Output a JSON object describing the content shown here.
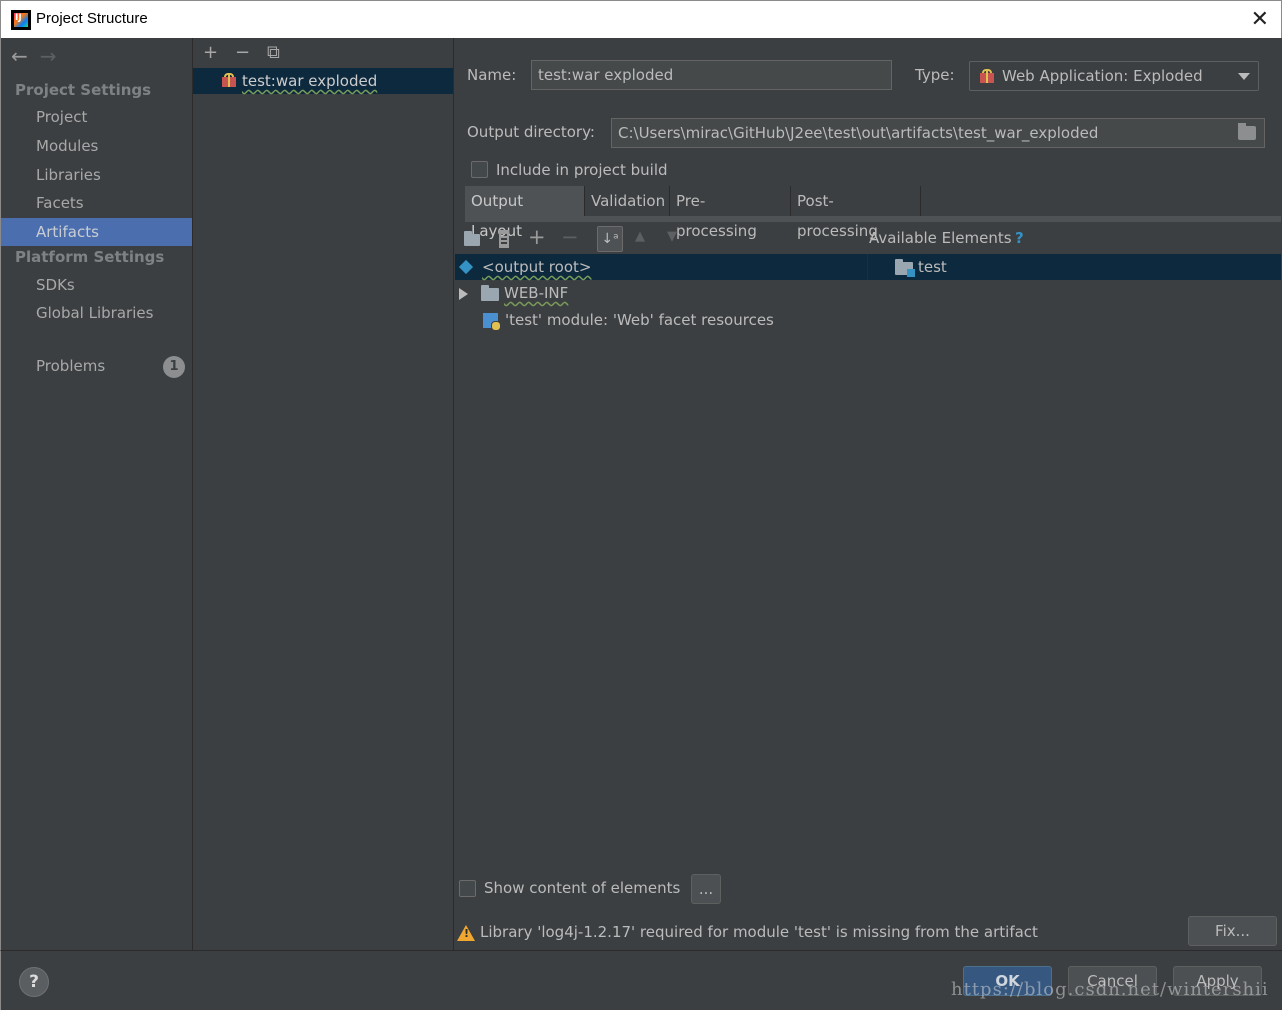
{
  "window": {
    "title": "Project Structure",
    "close_glyph": "✕"
  },
  "nav": {
    "back_glyph": "←",
    "forward_glyph": "→",
    "project_settings_header": "Project Settings",
    "project_items": [
      {
        "label": "Project"
      },
      {
        "label": "Modules"
      },
      {
        "label": "Libraries"
      },
      {
        "label": "Facets"
      },
      {
        "label": "Artifacts",
        "selected": true
      }
    ],
    "platform_settings_header": "Platform Settings",
    "platform_items": [
      {
        "label": "SDKs"
      },
      {
        "label": "Global Libraries"
      }
    ],
    "problems": {
      "label": "Problems",
      "count": "1"
    }
  },
  "artifacts_list": {
    "add_glyph": "+",
    "remove_glyph": "−",
    "copy_glyph": "⧉",
    "items": [
      {
        "label": "test:war exploded"
      }
    ]
  },
  "artifact": {
    "name_label": "Name:",
    "name_value": "test:war exploded",
    "type_label": "Type:",
    "type_value": "Web Application: Exploded",
    "output_dir_label": "Output directory:",
    "output_dir_value": "C:\\Users\\mirac\\GitHub\\J2ee\\test\\out\\artifacts\\test_war_exploded",
    "include_in_build_label": "Include in project build",
    "include_in_build_checked": false
  },
  "tabs": [
    {
      "label": "Output Layout",
      "active": true
    },
    {
      "label": "Validation"
    },
    {
      "label": "Pre-processing"
    },
    {
      "label": "Post-processing"
    }
  ],
  "layout_toolbar": {
    "add_glyph": "+",
    "remove_glyph": "−",
    "sort_glyph": "↓ᵃ",
    "up_glyph": "▲",
    "down_glyph": "▼",
    "available_elements_label": "Available Elements",
    "help_glyph": "?"
  },
  "output_tree": [
    {
      "label": "<output root>"
    },
    {
      "label": "WEB-INF"
    },
    {
      "label": "'test' module: 'Web' facet resources"
    }
  ],
  "available_tree": [
    {
      "label": "test"
    }
  ],
  "show_content": {
    "label": "Show content of elements",
    "checked": false,
    "ellipsis_label": "..."
  },
  "warning": {
    "message": "Library 'log4j-1.2.17' required for module 'test' is missing from the artifact",
    "fix_label": "Fix..."
  },
  "dialog_buttons": {
    "help_glyph": "?",
    "ok_label": "OK",
    "cancel_label": "Cancel",
    "apply_label": "Apply"
  },
  "watermark": "https://blog.csdn.net/wintershii",
  "colors": {
    "background": "#3c3f41",
    "selection": "#4b6eaf",
    "tree_selection": "#0d293e",
    "help_accent": "#3592c4",
    "warning": "#f0a732"
  }
}
